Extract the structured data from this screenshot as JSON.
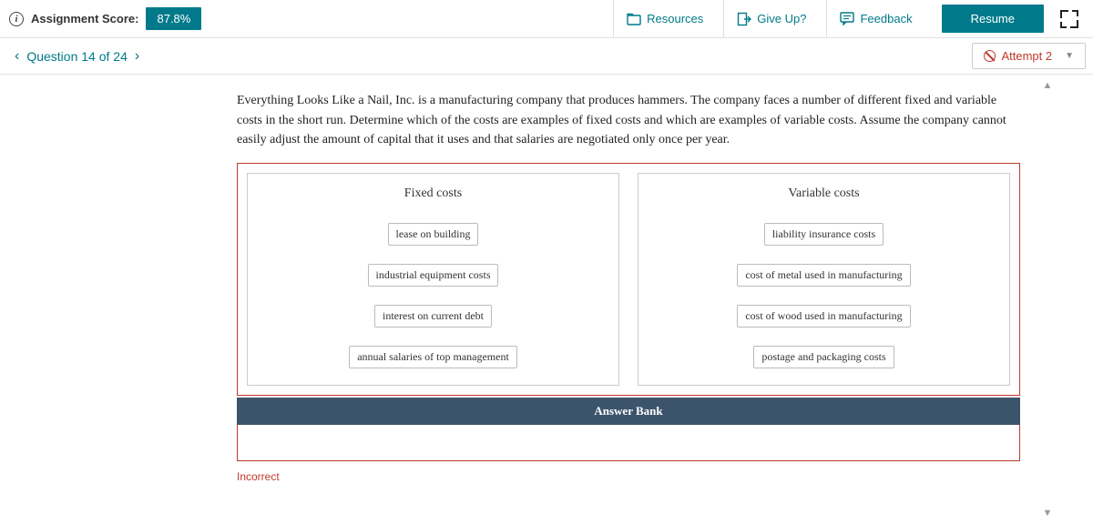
{
  "topbar": {
    "score_label": "Assignment Score:",
    "score_value": "87.8%",
    "resources": "Resources",
    "giveup": "Give Up?",
    "feedback": "Feedback",
    "resume": "Resume"
  },
  "nav": {
    "question_label": "Question 14 of 24",
    "attempt_label": "Attempt 2"
  },
  "prompt": "Everything Looks Like a Nail, Inc. is a manufacturing company that produces hammers. The company faces a number of different fixed and variable costs in the short run. Determine which of the costs are examples of fixed costs and which are examples of variable costs. Assume the company cannot easily adjust the amount of capital that it uses and that salaries are negotiated only once per year.",
  "zones": {
    "fixed_title": "Fixed costs",
    "variable_title": "Variable costs",
    "fixed_items": [
      "lease on building",
      "industrial equipment costs",
      "interest on current debt",
      "annual salaries of top management"
    ],
    "variable_items": [
      "liability insurance costs",
      "cost of metal used in manufacturing",
      "cost of wood used in manufacturing",
      "postage and packaging costs"
    ]
  },
  "answerbank_label": "Answer Bank",
  "status": "Incorrect"
}
